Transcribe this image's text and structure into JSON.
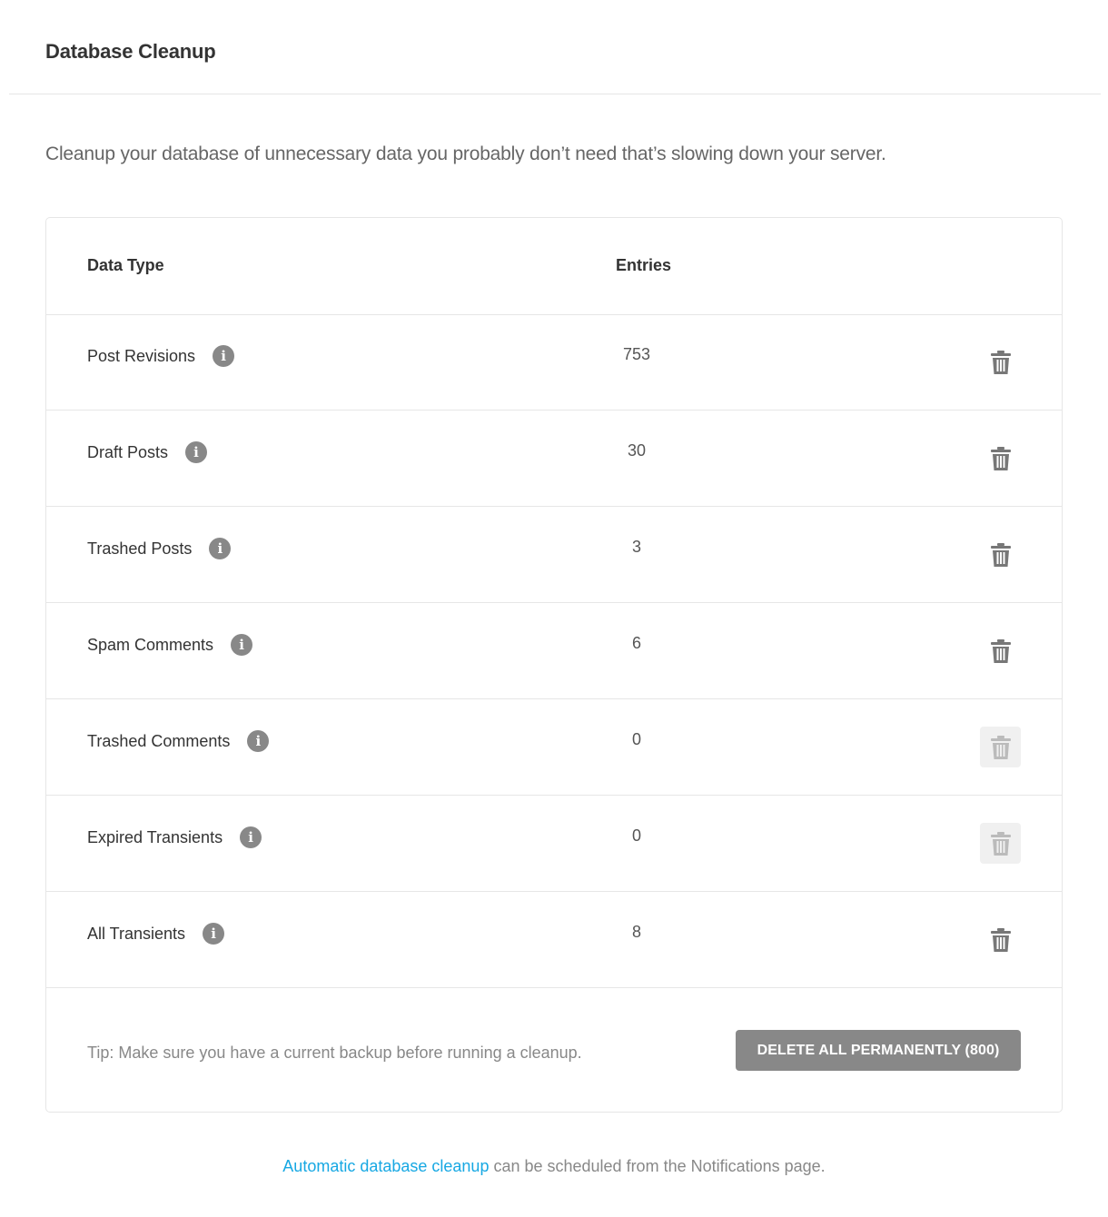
{
  "header": {
    "title": "Database Cleanup"
  },
  "description": "Cleanup your database of unnecessary data you probably don’t need that’s slowing down your server.",
  "table": {
    "columns": {
      "data_type": "Data Type",
      "entries": "Entries"
    },
    "rows": [
      {
        "label": "Post Revisions",
        "count": "753",
        "delete_enabled": true
      },
      {
        "label": "Draft Posts",
        "count": "30",
        "delete_enabled": true
      },
      {
        "label": "Trashed Posts",
        "count": "3",
        "delete_enabled": true
      },
      {
        "label": "Spam Comments",
        "count": "6",
        "delete_enabled": true
      },
      {
        "label": "Trashed Comments",
        "count": "0",
        "delete_enabled": false
      },
      {
        "label": "Expired Transients",
        "count": "0",
        "delete_enabled": false
      },
      {
        "label": "All Transients",
        "count": "8",
        "delete_enabled": true
      }
    ],
    "info_icon": "info-icon",
    "delete_icon": "trash-icon"
  },
  "footer": {
    "tip": "Tip: Make sure you have a current backup before running a cleanup.",
    "delete_all_label": "DELETE ALL PERMANENTLY (800)"
  },
  "bottom_note": {
    "link_text": "Automatic database cleanup",
    "rest_text": " can be scheduled from the Notifications page."
  },
  "colors": {
    "link": "#17a8e3",
    "button_gray": "#888888",
    "icon_active": "#777777",
    "icon_disabled": "#bbbbbb"
  }
}
